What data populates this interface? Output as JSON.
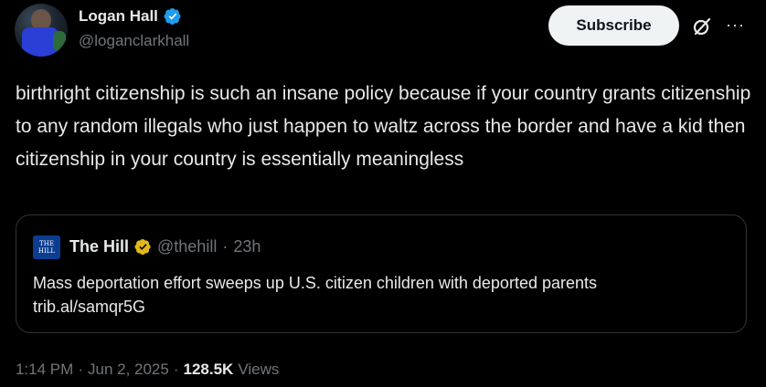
{
  "author": {
    "name": "Logan Hall",
    "handle": "@loganclarkhall"
  },
  "actions": {
    "subscribe_label": "Subscribe",
    "more_label": "···"
  },
  "tweet": {
    "text": "birthright citizenship is such an insane policy because if your country grants citizenship to any random illegals who just happen to waltz across the border and have a kid then citizenship in your country is essentially meaningless"
  },
  "quote": {
    "logo_text": "THE HILL",
    "name": "The Hill",
    "handle": "@thehill",
    "separator": "·",
    "time": "23h",
    "text_line1": "Mass deportation effort sweeps up U.S. citizen children with deported parents",
    "text_line2": "trib.al/samqr5G"
  },
  "meta": {
    "time": "1:14 PM",
    "sep1": "·",
    "date": "Jun 2, 2025",
    "sep2": "·",
    "views_count": "128.5K",
    "views_label": "Views"
  },
  "colors": {
    "background": "#000000",
    "text": "#e7e9ea",
    "muted": "#71767b",
    "verified_blue": "#1d9bf0",
    "verified_gold": "#e2b719",
    "border": "#2f3336"
  }
}
